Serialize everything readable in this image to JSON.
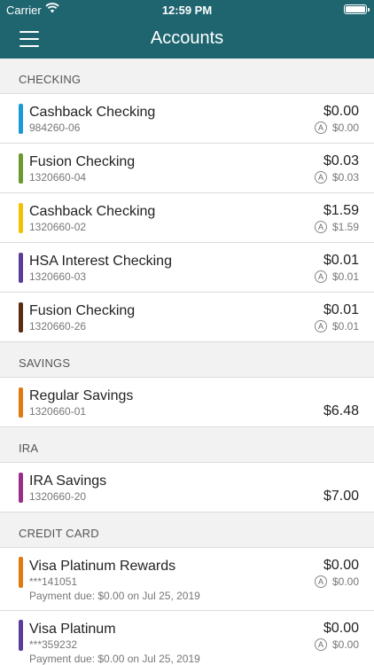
{
  "status_bar": {
    "carrier": "Carrier",
    "time": "12:59 PM"
  },
  "nav": {
    "title": "Accounts"
  },
  "sections": {
    "checking": {
      "label": "CHECKING",
      "accounts": [
        {
          "name": "Cashback Checking",
          "number": "984260-06",
          "balance": "$0.00",
          "available": "$0.00",
          "color": "#1a9bd7"
        },
        {
          "name": "Fusion Checking",
          "number": "1320660-04",
          "balance": "$0.03",
          "available": "$0.03",
          "color": "#6a9a2f"
        },
        {
          "name": "Cashback Checking",
          "number": "1320660-02",
          "balance": "$1.59",
          "available": "$1.59",
          "color": "#f2c200"
        },
        {
          "name": "HSA Interest Checking",
          "number": "1320660-03",
          "balance": "$0.01",
          "available": "$0.01",
          "color": "#5a3d99"
        },
        {
          "name": "Fusion Checking",
          "number": "1320660-26",
          "balance": "$0.01",
          "available": "$0.01",
          "color": "#5c2c0e"
        }
      ]
    },
    "savings": {
      "label": "SAVINGS",
      "accounts": [
        {
          "name": "Regular Savings",
          "number": "1320660-01",
          "balance": "$6.48",
          "color": "#e07a10"
        }
      ]
    },
    "ira": {
      "label": "IRA",
      "accounts": [
        {
          "name": "IRA Savings",
          "number": "1320660-20",
          "balance": "$7.00",
          "color": "#9a2d86"
        }
      ]
    },
    "credit_card": {
      "label": "CREDIT CARD",
      "accounts": [
        {
          "name": "Visa Platinum Rewards",
          "number": "***141051",
          "payment_due": "Payment due: $0.00 on Jul 25, 2019",
          "balance": "$0.00",
          "available": "$0.00",
          "color": "#e07a10"
        },
        {
          "name": "Visa Platinum",
          "number": "***359232",
          "payment_due": "Payment due: $0.00 on Jul 25, 2019",
          "balance": "$0.00",
          "available": "$0.00",
          "color": "#5a3d99"
        }
      ]
    }
  }
}
